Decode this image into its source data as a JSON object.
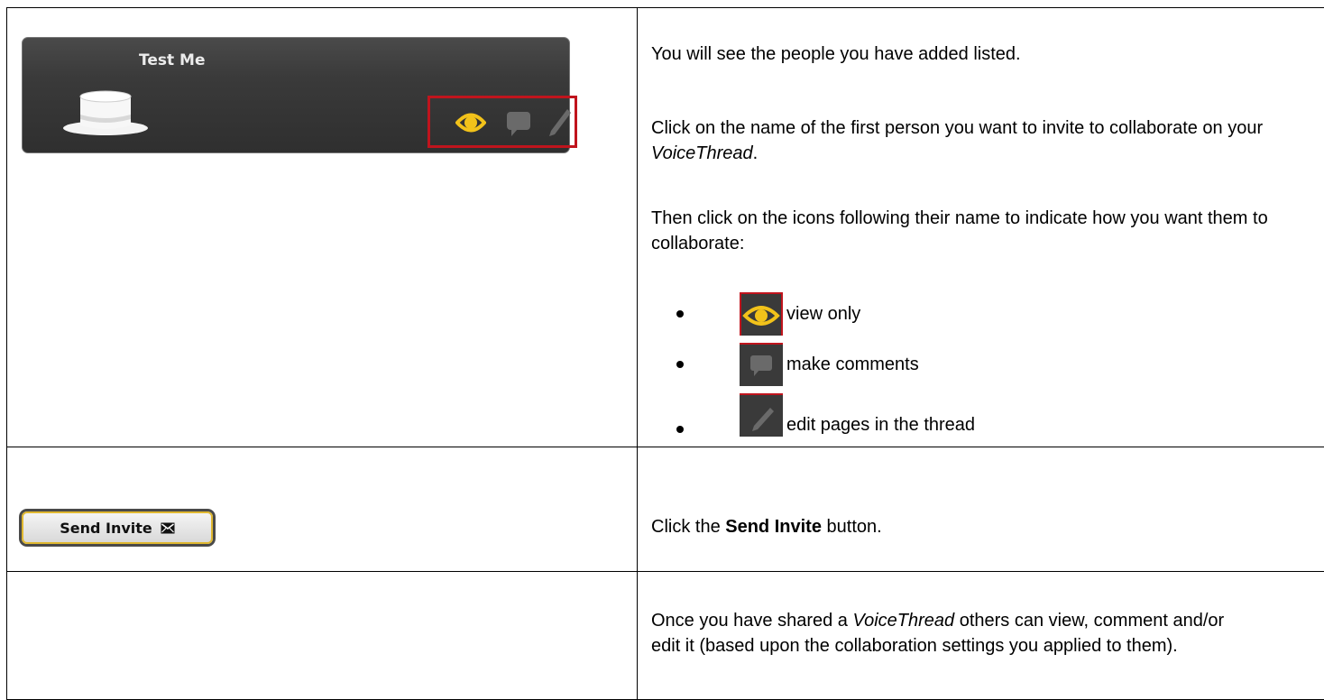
{
  "row1": {
    "card": {
      "name": "Test Me",
      "avatar_icon": "top-hat-icon",
      "permission_icons": [
        "eye-icon",
        "comment-bubble-icon",
        "pencil-icon"
      ],
      "highlight_color": "#c0141d",
      "eye_color": "#f2c21a"
    },
    "p1": "You will see the people you have added listed.",
    "p2_before": "Click on the name of the first person you want to invite to collaborate on your ",
    "p2_italic": "VoiceThread",
    "p2_after": ".",
    "p3": "Then click on the icons following their name to indicate how you want them to collaborate:",
    "bullets": [
      {
        "icon": "eye-icon",
        "label": "view only"
      },
      {
        "icon": "comment-bubble-icon",
        "label": "make comments"
      },
      {
        "icon": "pencil-icon",
        "label": "edit pages in the thread"
      }
    ]
  },
  "row2": {
    "button_label": "Send Invite",
    "button_icon": "envelope-icon",
    "text_before": "Click the ",
    "text_bold": "Send Invite",
    "text_after": " button."
  },
  "row3": {
    "text_before": "Once you have shared a ",
    "text_italic": "VoiceThread",
    "text_after": " others can view, comment and/or edit it (based upon the collaboration settings you applied to them)."
  }
}
